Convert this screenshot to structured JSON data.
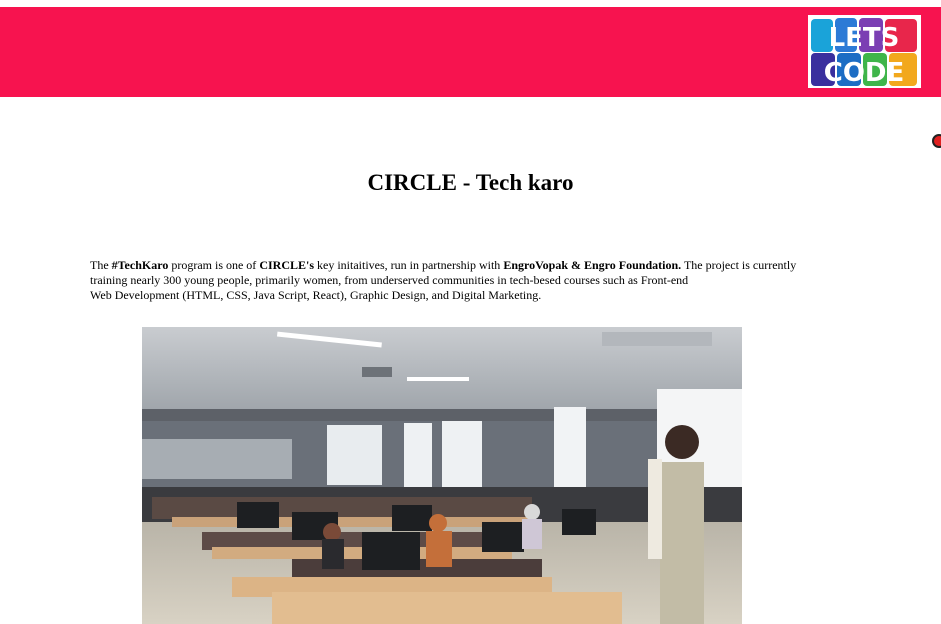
{
  "header": {
    "bar_color": "#f7134f",
    "logo": {
      "line1": "LETS",
      "line2": "CODE"
    }
  },
  "main": {
    "title": "CIRCLE - Tech karo",
    "intro": {
      "p1": "The ",
      "b1": "#TechKaro",
      "p2": " program is one of ",
      "b2": "CIRCLE's",
      "p3": " key initaitives, run in partnership with ",
      "b3": "EngroVopak & Engro Foundation.",
      "p4": " The project is currently training nearly 300 young people, primarily women, from underserved communities in tech-besed courses such as Front-end",
      "p5": "Web Development (HTML, CSS, Java Script, React), Graphic Design, and Digital Marketing."
    },
    "photo": {
      "icon": "classroom-photo"
    }
  }
}
